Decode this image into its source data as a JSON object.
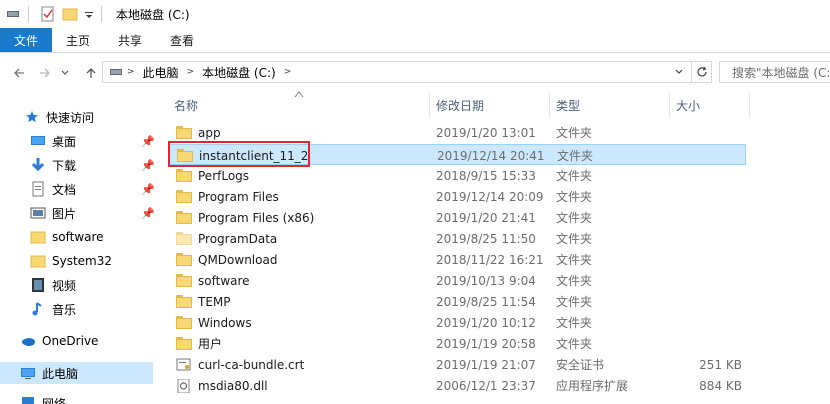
{
  "window": {
    "title": "本地磁盘 (C:)"
  },
  "ribbon": {
    "tabs": [
      "文件",
      "主页",
      "共享",
      "查看"
    ]
  },
  "address": {
    "crumbs": [
      "此电脑",
      "本地磁盘 (C:)"
    ],
    "search_placeholder": "搜索\"本地磁盘 (C:)\""
  },
  "nav": {
    "quick_access": "快速访问",
    "items": [
      {
        "label": "桌面",
        "icon": "desktop-icon",
        "pinned": true
      },
      {
        "label": "下载",
        "icon": "download-icon",
        "pinned": true
      },
      {
        "label": "文档",
        "icon": "document-icon",
        "pinned": true
      },
      {
        "label": "图片",
        "icon": "picture-icon",
        "pinned": true
      },
      {
        "label": "software",
        "icon": "folder-icon",
        "pinned": false
      },
      {
        "label": "System32",
        "icon": "folder-icon",
        "pinned": false
      },
      {
        "label": "视频",
        "icon": "video-icon",
        "pinned": false
      },
      {
        "label": "音乐",
        "icon": "music-icon",
        "pinned": false
      }
    ],
    "onedrive": "OneDrive",
    "this_pc": "此电脑",
    "network": "网络"
  },
  "columns": {
    "name": "名称",
    "date": "修改日期",
    "type": "类型",
    "size": "大小"
  },
  "files": [
    {
      "name": "app",
      "date": "2019/1/20 13:01",
      "type": "文件夹",
      "size": "",
      "icon": "folder-icon"
    },
    {
      "name": "instantclient_11_2",
      "date": "2019/12/14 20:41",
      "type": "文件夹",
      "size": "",
      "icon": "folder-icon"
    },
    {
      "name": "PerfLogs",
      "date": "2018/9/15 15:33",
      "type": "文件夹",
      "size": "",
      "icon": "folder-icon"
    },
    {
      "name": "Program Files",
      "date": "2019/12/14 20:09",
      "type": "文件夹",
      "size": "",
      "icon": "folder-icon"
    },
    {
      "name": "Program Files (x86)",
      "date": "2019/1/20 21:41",
      "type": "文件夹",
      "size": "",
      "icon": "folder-icon"
    },
    {
      "name": "ProgramData",
      "date": "2019/8/25 11:50",
      "type": "文件夹",
      "size": "",
      "icon": "folder-icon"
    },
    {
      "name": "QMDownload",
      "date": "2018/11/22 16:21",
      "type": "文件夹",
      "size": "",
      "icon": "folder-icon"
    },
    {
      "name": "software",
      "date": "2019/10/13 9:04",
      "type": "文件夹",
      "size": "",
      "icon": "folder-icon"
    },
    {
      "name": "TEMP",
      "date": "2019/8/25 11:54",
      "type": "文件夹",
      "size": "",
      "icon": "folder-icon"
    },
    {
      "name": "Windows",
      "date": "2019/1/20 10:12",
      "type": "文件夹",
      "size": "",
      "icon": "folder-icon"
    },
    {
      "name": "用户",
      "date": "2019/1/19 20:58",
      "type": "文件夹",
      "size": "",
      "icon": "folder-icon"
    },
    {
      "name": "curl-ca-bundle.crt",
      "date": "2019/1/19 21:07",
      "type": "安全证书",
      "size": "251 KB",
      "icon": "certificate-icon"
    },
    {
      "name": "msdia80.dll",
      "date": "2006/12/1 23:37",
      "type": "应用程序扩展",
      "size": "884 KB",
      "icon": "dll-file-icon"
    }
  ],
  "selected_file": "instantclient_11_2",
  "colors": {
    "accent": "#1979ca",
    "selection": "#cce8ff",
    "highlight_border": "#e0262e",
    "folder": "#f8d775"
  }
}
